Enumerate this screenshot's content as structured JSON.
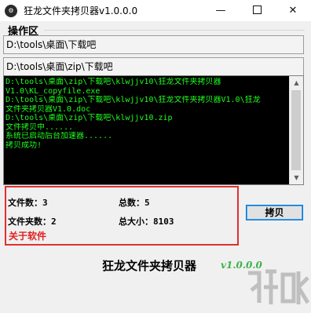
{
  "window": {
    "icon_glyph": "⚙",
    "title": "狂龙文件夹拷贝器v1.0.0.0",
    "controls": {
      "minimize": "—",
      "close": "✕"
    }
  },
  "section": {
    "title": "操作区"
  },
  "paths": {
    "source": "D:\\tools\\桌面\\下载吧",
    "target": "D:\\tools\\桌面\\zip\\下载吧"
  },
  "console": {
    "lines": [
      "D:\\tools\\桌面\\zip\\下载吧\\klwjjv10\\狂龙文件夹拷贝器",
      "V1.0\\KL_copyfile.exe",
      "D:\\tools\\桌面\\zip\\下载吧\\klwjjv10\\狂龙文件夹拷贝器V1.0\\狂龙",
      "文件夹拷贝器V1.0.doc",
      "D:\\tools\\桌面\\zip\\下载吧\\klwjjv10.zip",
      "文件拷贝中......",
      "系统已启动后台加速器......",
      "拷贝成功!"
    ],
    "scroll_up": "▲",
    "scroll_down": "▼"
  },
  "stats": {
    "file_count_label": "文件数：",
    "file_count": "3",
    "total_label": "总数：",
    "total": "5",
    "folder_count_label": "文件夹数：",
    "folder_count": "2",
    "total_size_label": "总大小：",
    "total_size": "8103"
  },
  "about_link": "关于软件",
  "copy_button": "拷贝",
  "footer": {
    "app_name": "狂龙文件夹拷贝器",
    "version": "v1.0.0.0"
  },
  "colors": {
    "console_bg": "#000000",
    "console_text": "#1dff1d",
    "highlight_box": "#e03030",
    "about_link": "#e02020",
    "version_text": "#3db24a",
    "button_focus": "#0078d7"
  }
}
